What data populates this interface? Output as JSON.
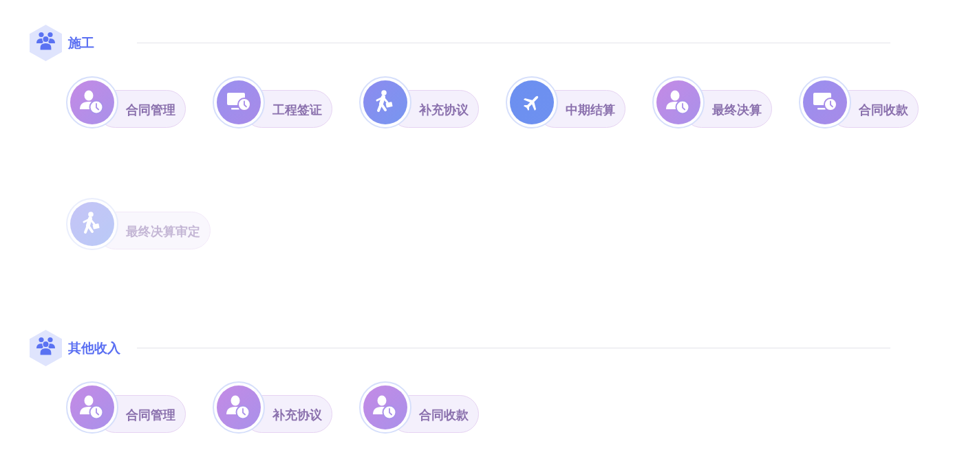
{
  "sections": [
    {
      "title": "施工",
      "items": [
        {
          "label": "合同管理",
          "kind": "user_clock",
          "disabled": false
        },
        {
          "label": "工程签证",
          "kind": "monitor_clock",
          "disabled": false
        },
        {
          "label": "补充协议",
          "kind": "walker",
          "disabled": false
        },
        {
          "label": "中期结算",
          "kind": "plane",
          "disabled": false
        },
        {
          "label": "最终决算",
          "kind": "user_clock",
          "disabled": false
        },
        {
          "label": "合同收款",
          "kind": "monitor_clock",
          "disabled": false
        },
        {
          "label": "最终决算审定",
          "kind": "walker",
          "disabled": true
        }
      ]
    },
    {
      "title": "其他收入",
      "items": [
        {
          "label": "合同管理",
          "kind": "user_clock",
          "disabled": false
        },
        {
          "label": "补充协议",
          "kind": "user_clock",
          "disabled": false
        },
        {
          "label": "合同收款",
          "kind": "user_clock",
          "disabled": false
        }
      ]
    }
  ]
}
